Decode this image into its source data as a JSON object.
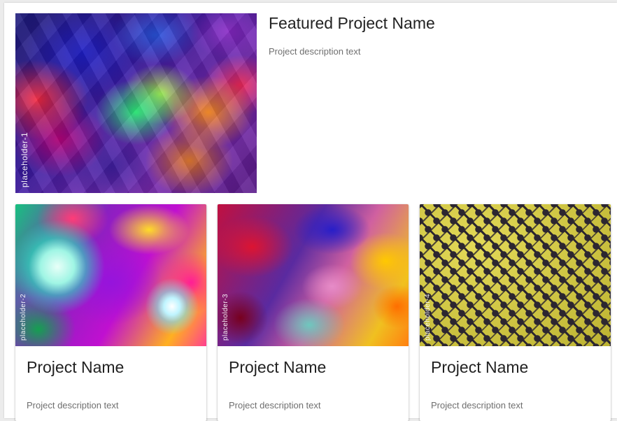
{
  "featured": {
    "image_label": "placeholder-1",
    "title": "Featured Project Name",
    "description": "Project description text"
  },
  "cards": [
    {
      "image_label": "placeholder-2",
      "title": "Project Name",
      "description": "Project description text"
    },
    {
      "image_label": "placeholder-3",
      "title": "Project Name",
      "description": "Project description text"
    },
    {
      "image_label": "placeholder-4",
      "title": "Project Name",
      "description": "Project description text"
    }
  ]
}
